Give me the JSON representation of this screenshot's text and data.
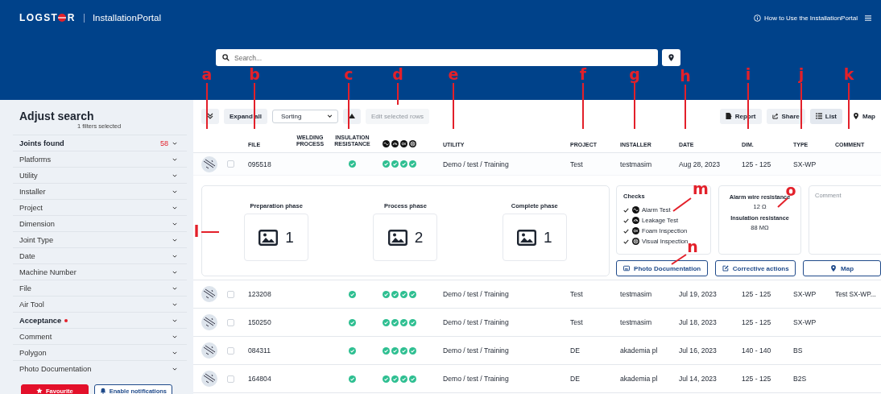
{
  "header": {
    "logo_left": "LOGST",
    "logo_right": "R",
    "app_name": "InstallationPortal",
    "help_link": "How to Use the InstallationPortal"
  },
  "search": {
    "placeholder": "Search..."
  },
  "sidebar": {
    "title": "Adjust search",
    "subtitle": "1 filters selected",
    "filters": [
      {
        "label": "Joints found",
        "count": "58",
        "emphasized": true,
        "flagged": false
      },
      {
        "label": "Platforms",
        "emphasized": false,
        "flagged": false
      },
      {
        "label": "Utility",
        "emphasized": false,
        "flagged": false
      },
      {
        "label": "Installer",
        "emphasized": false,
        "flagged": false
      },
      {
        "label": "Project",
        "emphasized": false,
        "flagged": false
      },
      {
        "label": "Dimension",
        "emphasized": false,
        "flagged": false
      },
      {
        "label": "Joint Type",
        "emphasized": false,
        "flagged": false
      },
      {
        "label": "Date",
        "emphasized": false,
        "flagged": false
      },
      {
        "label": "Machine Number",
        "emphasized": false,
        "flagged": false
      },
      {
        "label": "File",
        "emphasized": false,
        "flagged": false
      },
      {
        "label": "Air Tool",
        "emphasized": false,
        "flagged": false
      },
      {
        "label": "Acceptance",
        "emphasized": true,
        "flagged": true
      },
      {
        "label": "Comment",
        "emphasized": false,
        "flagged": false
      },
      {
        "label": "Polygon",
        "emphasized": false,
        "flagged": false
      },
      {
        "label": "Photo Documentation",
        "emphasized": false,
        "flagged": false
      }
    ],
    "buttons": [
      {
        "label": "Favourite",
        "kind": "primary"
      },
      {
        "label": "Enable notifications",
        "kind": "outline"
      }
    ]
  },
  "toolbar": {
    "expand_all": "Expand all",
    "sorting": "Sorting",
    "edit_rows": {
      "label": "Edit selected rows",
      "disabled": true
    },
    "actions": [
      "Report",
      "Share"
    ],
    "views": [
      {
        "label": "List",
        "selected": true
      },
      {
        "label": "Map",
        "selected": false
      }
    ]
  },
  "table": {
    "columns": [
      "FILE",
      "WELDING PROCESS",
      "INSULATION RESISTANCE",
      "UTILITY",
      "PROJECT",
      "INSTALLER",
      "DATE",
      "DIM.",
      "TYPE",
      "COMMENT"
    ],
    "rows": [
      {
        "file": "095518",
        "selected": false,
        "expanded": true,
        "insulation_ok": true,
        "checks": [
          true,
          true,
          true,
          true
        ],
        "utility": "Demo / test / Training",
        "project": "Test",
        "installer": "testmasim",
        "date": "Aug 28, 2023",
        "dim": "125 - 125",
        "type": "SX-WP",
        "detail": {
          "phases": [
            {
              "label": "Preparation phase",
              "count": "1"
            },
            {
              "label": "Process phase",
              "count": "2"
            },
            {
              "label": "Complete phase",
              "count": "1"
            }
          ],
          "checks_title": "Checks",
          "checks": [
            {
              "label": "Alarm Test",
              "checked": true
            },
            {
              "label": "Leakage Test",
              "checked": true
            },
            {
              "label": "Foam Inspection",
              "checked": true
            },
            {
              "label": "Visual Inspection",
              "checked": true
            }
          ],
          "resistance": [
            {
              "label": "Alarm wire resistance",
              "value": "12 Ω"
            },
            {
              "label": "Insulation resistance",
              "value": "88 MΩ"
            }
          ],
          "comment_placeholder": "Comment",
          "buttons": [
            "Photo Documentation",
            "Corrective actions",
            "Map"
          ]
        }
      },
      {
        "file": "123208",
        "selected": false,
        "expanded": false,
        "insulation_ok": true,
        "checks": [
          true,
          true,
          true,
          true
        ],
        "utility": "Demo / test / Training",
        "project": "Test",
        "installer": "testmasim",
        "date": "Jul 19, 2023",
        "dim": "125 - 125",
        "type": "SX-WP",
        "comment": "Test SX-WP..."
      },
      {
        "file": "150250",
        "selected": false,
        "expanded": false,
        "insulation_ok": true,
        "checks": [
          true,
          true,
          true,
          true
        ],
        "utility": "Demo / test / Training",
        "project": "Test",
        "installer": "testmasim",
        "date": "Jul 18, 2023",
        "dim": "125 - 125",
        "type": "SX-WP"
      },
      {
        "file": "084311",
        "selected": false,
        "expanded": false,
        "insulation_ok": true,
        "checks": [
          true,
          true,
          true,
          true
        ],
        "utility": "Demo / test / Training",
        "project": "DE",
        "installer": "akademia pl",
        "date": "Jul 16, 2023",
        "dim": "140 - 140",
        "type": "BS"
      },
      {
        "file": "164804",
        "selected": false,
        "expanded": false,
        "insulation_ok": true,
        "checks": [
          true,
          true,
          true,
          true
        ],
        "utility": "Demo / test / Training",
        "project": "DE",
        "installer": "akademia pl",
        "date": "Jul 14, 2023",
        "dim": "125 - 125",
        "type": "B2S"
      }
    ]
  },
  "annotations": [
    {
      "letter": "a"
    },
    {
      "letter": "b"
    },
    {
      "letter": "c"
    },
    {
      "letter": "d"
    },
    {
      "letter": "e"
    },
    {
      "letter": "f"
    },
    {
      "letter": "g"
    },
    {
      "letter": "h"
    },
    {
      "letter": "i"
    },
    {
      "letter": "j"
    },
    {
      "letter": "k"
    },
    {
      "letter": "l"
    },
    {
      "letter": "m"
    },
    {
      "letter": "n"
    },
    {
      "letter": "o"
    }
  ]
}
